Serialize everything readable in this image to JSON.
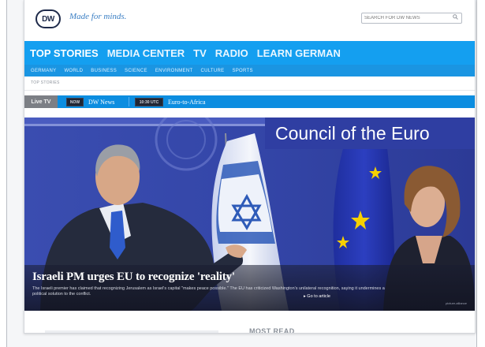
{
  "header": {
    "logo_text": "DW",
    "tagline": "Made for minds.",
    "search_placeholder": "SEARCH FOR DW NEWS"
  },
  "nav": {
    "main": [
      {
        "label": "TOP STORIES",
        "active": true
      },
      {
        "label": "MEDIA CENTER",
        "active": false
      },
      {
        "label": "TV",
        "active": false
      },
      {
        "label": "RADIO",
        "active": false
      },
      {
        "label": "LEARN GERMAN",
        "active": false
      }
    ],
    "sub": [
      "GERMANY",
      "WORLD",
      "BUSINESS",
      "SCIENCE",
      "ENVIRONMENT",
      "CULTURE",
      "SPORTS"
    ],
    "breadcrumb": "TOP STORIES"
  },
  "livebar": {
    "live_tv_label": "Live TV",
    "items": [
      {
        "badge": "NOW",
        "label": "DW News"
      },
      {
        "badge": "10:30 UTC",
        "label": "Euro-to-Africa"
      }
    ]
  },
  "hero": {
    "background_text": "Council of the Euro",
    "headline": "Israeli PM urges EU to recognize 'reality'",
    "teaser": "The Israeli premier has claimed that recognizing Jerusalem as Israel's capital \"makes peace possible.\" The EU has criticized Washington's unilateral recognition, saying it undermines a political solution to the conflict.",
    "goto_label": "Go to article",
    "photo_credit": "picture-alliance"
  },
  "below": {
    "most_read_label": "MOST READ"
  },
  "colors": {
    "nav_blue": "#149ff0",
    "live_bar_blue": "#0c8de0",
    "brand_dark": "#1e2a4a"
  }
}
